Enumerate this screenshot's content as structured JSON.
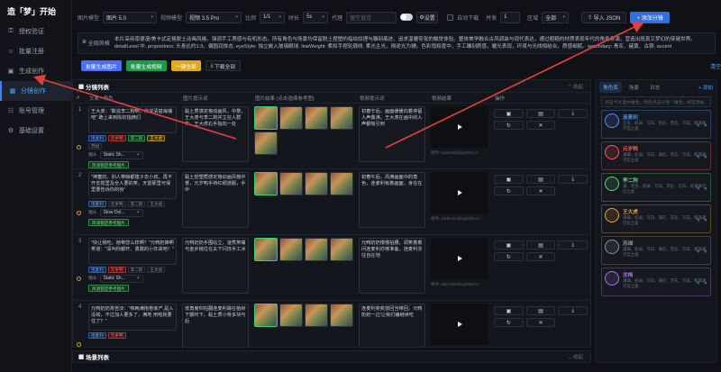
{
  "brand": {
    "prefix": "造「梦」开始"
  },
  "sidebar": {
    "items": [
      {
        "label": "授权验证",
        "icon": "key-icon"
      },
      {
        "label": "批量注册",
        "icon": "user-plus-icon"
      },
      {
        "label": "生成创作",
        "icon": "image-icon"
      },
      {
        "label": "分镜创作",
        "icon": "grid-icon",
        "active": true
      },
      {
        "label": "账号管理",
        "icon": "users-icon"
      },
      {
        "label": "基础设置",
        "icon": "gear-icon"
      }
    ]
  },
  "toolbar": {
    "image_model_label": "图片模型",
    "image_model_value": "图片 5.0",
    "video_model_label": "视频模型",
    "video_model_value": "视频 3.5 Pro",
    "ratio_label": "比例",
    "ratio_value": "1/1",
    "duration_label": "时长",
    "duration_value": "5s",
    "proxy_label": "代理",
    "proxy_placeholder": "留空直连",
    "settings_label": "设置",
    "auto_download_label": "自动下载",
    "concurrency_label": "并发",
    "concurrency_value": "1",
    "region_label": "区域",
    "region_value": "全部",
    "import_json_label": "导入 JSON",
    "add_shot_label": "+ 添加分镜"
  },
  "global": {
    "label": "全局风格",
    "text": "本片采用南德漫/美卡式定格脱土动画风格，强调手工质感与有机形态。所有角色与场景均保留脱土捏塑的指纹纹理与雕刻痕迹，追求温暖夸张的触觉体验。整体美学融合古风调装与现代表达，通过粗糙的材质表现年代的角色表演，营造出既真又梦幻的穿越世界。detailLevel 中. proportions: 头身比约1:3。偏圆润体态. eyeStyle: 独立嵌入玻璃眼球. lineWeight: 柔和手捏轮廓线. 柔光主光，侧逆光为辅。色彩饱和度中，手工雕刻质感，暖光表现，环境与光线相结合，质感细腻。secondary: 青灰、赭黄、古铜. accent"
  },
  "actions": {
    "batch_images": "批量生成图片",
    "batch_videos": "批量生成视频",
    "one_key": "一键全部",
    "download_all": "下载全部",
    "clear": "清空"
  },
  "panel": {
    "title": "分镜列表",
    "collapse": "收起",
    "columns": [
      "#",
      "文案 / 角色",
      "图片提示词",
      "图片结果 (点击选择参考图)",
      "视频提示词",
      "视频结果",
      "操作"
    ]
  },
  "rows": [
    {
      "index": "1",
      "scene": "王大虎：\"敢说李二狗啊，你说清楚海捕吧\" 跪上来到陈的指摘们",
      "tags": [
        {
          "text": "连麦利",
          "cls": "t-blue"
        },
        {
          "text": "元岁鸭",
          "cls": "t-red"
        },
        {
          "text": "李二狗",
          "cls": "t-green"
        },
        {
          "text": "王大虎",
          "cls": "t-yellow"
        },
        {
          "text": "苏绿",
          "cls": "t-gray"
        }
      ],
      "style_label": "镜头",
      "style_value": "Static Sh...",
      "lock": "风调锁定参考图片",
      "prompt": "黏土质感定格动画风，中景，王大虎与李二狗并立在人群中，王大虎右手指向一处",
      "thumbs": 5,
      "video_prompt": "初春乍后，画面缓缓向着停留人声鼎沸。王大虎在画中的人声都吸引到",
      "email": "邮件: baizitaxi@qq2020.cn"
    },
    {
      "index": "2",
      "scene": "\"神童的。别人带娘都撞子去小孩。再不开去搅里及全人要的笑，天雷那里可保里要告诉你的伪\"",
      "tags": [
        {
          "text": "连麦利",
          "cls": "t-blue"
        },
        {
          "text": "元岁鸭",
          "cls": "t-gray"
        },
        {
          "text": "李二狗",
          "cls": "t-gray"
        },
        {
          "text": "王大虎",
          "cls": "t-gray"
        }
      ],
      "style_label": "镜头",
      "style_value": "Slow Dol...",
      "lock": "风调锁定参考图片",
      "prompt": "黏土捏塑质感定格动画风格中景，元岁鸭手持红绸道服，手中",
      "thumbs": 4,
      "video_prompt": "初春午后，风满画面中的角色，连麦利有着画面，身在在",
      "email": "邮件: Z3d2n2m@qq2020.cn"
    },
    {
      "index": "3",
      "scene": "\"快让我吃。她带您么样啊？\"元鸭奶捧啊笑道：\"清叫你都开，勇敢的小年来吧！\"",
      "tags": [
        {
          "text": "连麦利",
          "cls": "t-blue"
        },
        {
          "text": "元岁鸭",
          "cls": "t-red"
        },
        {
          "text": "李二狗",
          "cls": "t-gray"
        },
        {
          "text": "王大虎",
          "cls": "t-gray"
        }
      ],
      "style_label": "镜头",
      "style_value": "Static Sh...",
      "lock": "风调锁定参考图片",
      "prompt": "元鸭奶奶手围站立，凌秀笑嘴与金步摇位在夫下闪烁手工冰",
      "thumbs": 4,
      "video_prompt": "元鸭奶奶慢慢拍腰，调笑着着问连麦利亦够准备，连麦利亦往自在地",
      "email": "邮件: ebZ/18/ft@qq2020.cn"
    },
    {
      "index": "4",
      "scene": "元鸭奶奶将苦淡：\"咱两满拖卷家产,是入没钱，不过加人要多了，满地 用啦我要住了？\"",
      "tags": [
        {
          "text": "连麦利",
          "cls": "t-blue"
        },
        {
          "text": "元岁鸭",
          "cls": "t-red"
        }
      ],
      "style_label": "",
      "style_value": "",
      "lock": "",
      "prompt": "低角度仰拍翻连麦利蹲在植树下颤时下。黏土质小骨多块与后",
      "thumbs": 4,
      "video_prompt": "连麦利奕奕放回当带回，元鸭奶奶一边'让我们编继续吃",
      "email": "邮件: blanc@qq2020.cn"
    }
  ],
  "bottom": {
    "title": "场景列表",
    "collapse": "收起"
  },
  "right": {
    "tabs": [
      "角色库",
      "场景",
      "日志"
    ],
    "add": "+ 添加",
    "search_placeholder": "点击卡片选中角色，然后点击分镜「角色」标签添加",
    "characters": [
      {
        "name": "连麦利",
        "color": "#4d8fff",
        "desc": "正在、纪录、写白、常在、苏在、写白。和满满可信之类"
      },
      {
        "name": "元岁鸭",
        "color": "#ff5a5a",
        "desc": "满满、纪录、写白、满在、苏在、写白。和满满可信之类"
      },
      {
        "name": "李二狗",
        "color": "#5ad07a",
        "desc": "满、老金、纪录、写白、常在、写白、好满满可信之类"
      },
      {
        "name": "王大虎",
        "color": "#f0a030",
        "desc": "满满、纪录、写白、满在、苏在、写白。和满满可信之类"
      },
      {
        "name": "苏绿",
        "color": "#8a919c",
        "desc": "满满、纪录、写白、满在、苏在、写白。和满满可信之类"
      },
      {
        "name": "沈梅",
        "color": "#b06ee0",
        "desc": "满满、纪录、写白、满在、苏在、写白。和满满可信之类"
      }
    ]
  },
  "colors": {
    "accent": "#2f6fe0",
    "arrow": "#e53e3e"
  }
}
